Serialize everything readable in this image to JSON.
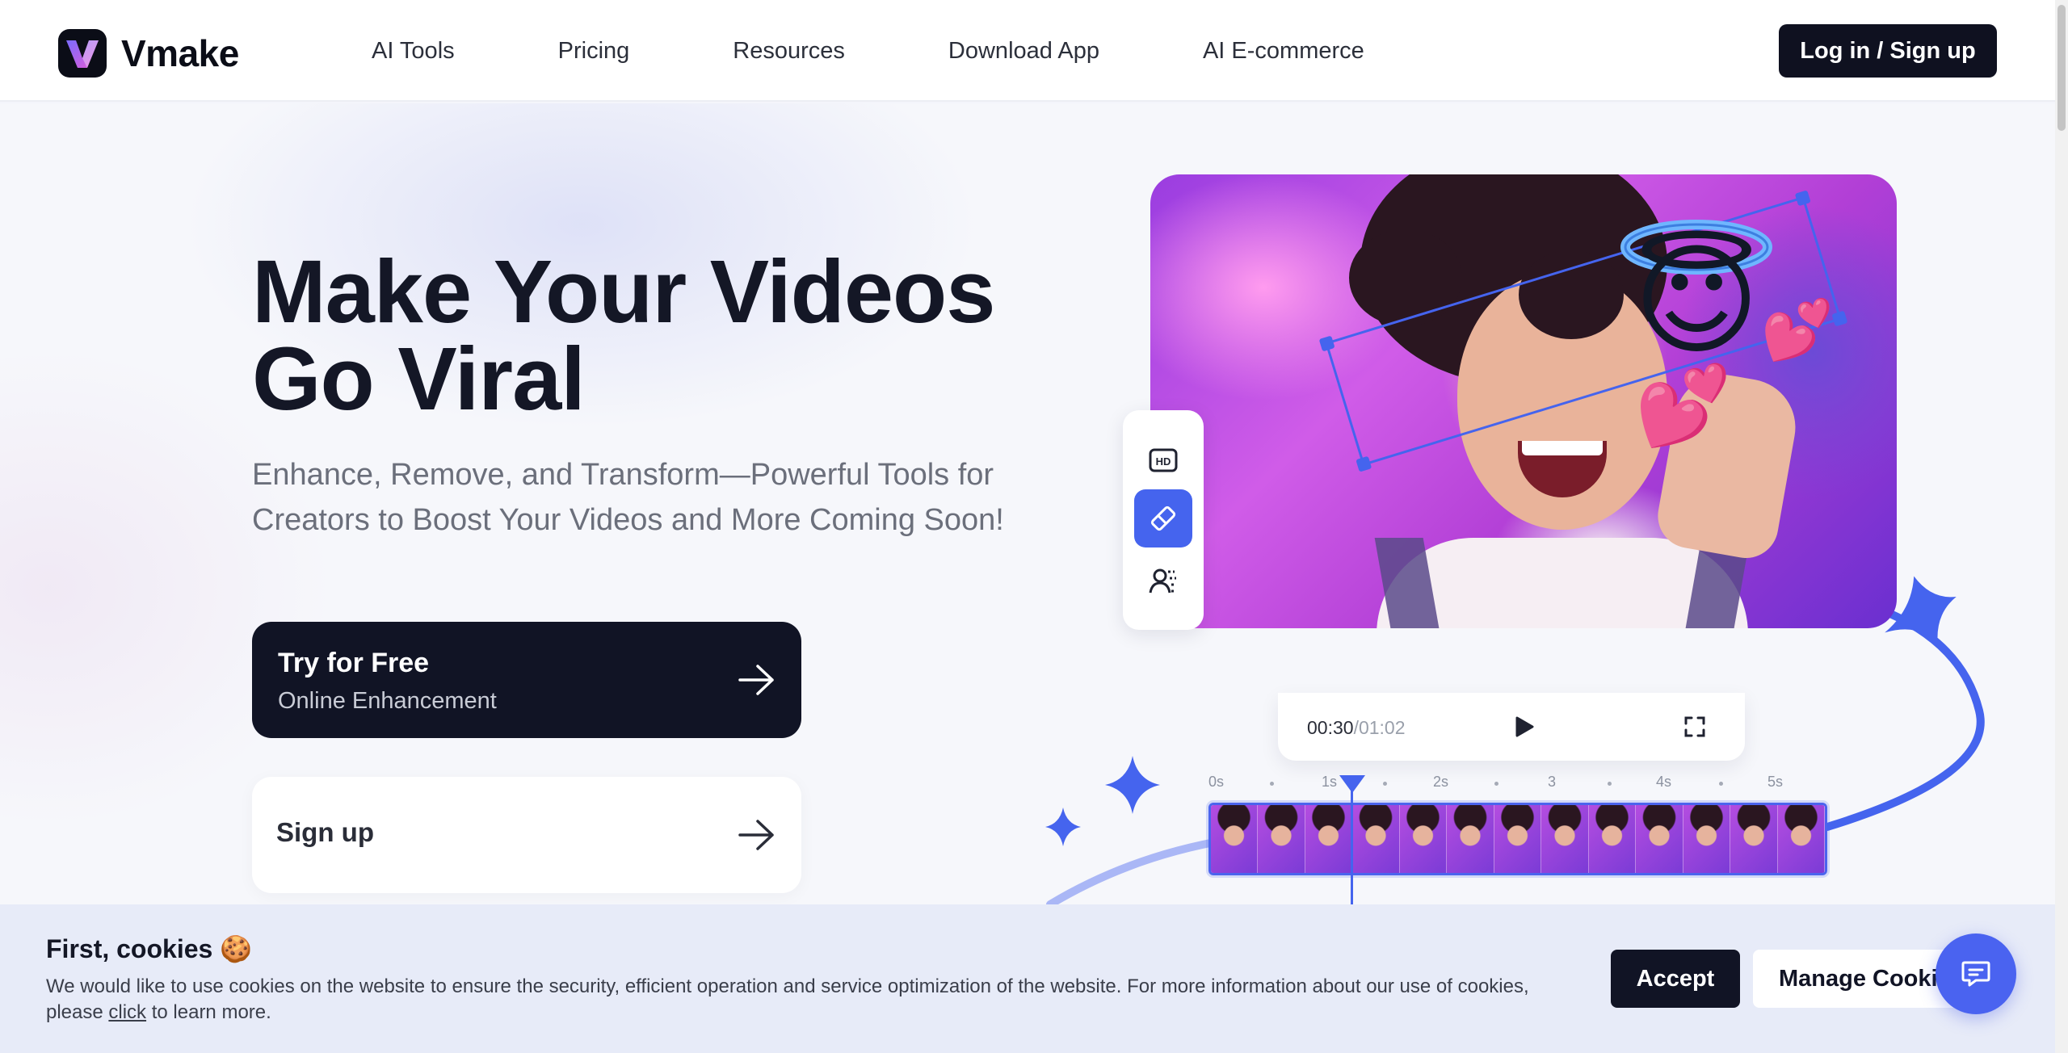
{
  "brand": {
    "name": "Vmake"
  },
  "nav": {
    "items": [
      {
        "label": "AI Tools"
      },
      {
        "label": "Pricing"
      },
      {
        "label": "Resources"
      },
      {
        "label": "Download App"
      },
      {
        "label": "AI E-commerce"
      }
    ],
    "login_label": "Log in / Sign up"
  },
  "hero": {
    "title_line1": "Make Your Videos",
    "title_line2": "Go Viral",
    "subtitle": "Enhance, Remove, and Transform—Powerful Tools for Creators to Boost Your Videos and More Coming Soon!",
    "cta_primary": {
      "title": "Try for Free",
      "subtitle": "Online Enhancement"
    },
    "cta_secondary": {
      "title": "Sign up"
    }
  },
  "editor": {
    "tools": [
      {
        "icon": "hd-icon"
      },
      {
        "icon": "eraser-icon",
        "active": true
      },
      {
        "icon": "portrait-cutout-icon"
      }
    ],
    "player": {
      "current_time": "00:30",
      "duration": "/01:02"
    },
    "ruler": [
      "0s",
      "1s",
      "2s",
      "3",
      "4s",
      "5s"
    ],
    "emoji": "😇",
    "hearts": "💕"
  },
  "cookie": {
    "title": "First, cookies 🍪",
    "text_before": "We would like to use cookies on the website to ensure the security, efficient operation and service optimization of the website. For more information about our use of cookies, please ",
    "link": "click",
    "text_after": " to learn more.",
    "accept_label": "Accept",
    "manage_label": "Manage Cookies"
  },
  "colors": {
    "accent": "#4564ee",
    "dark": "#111425"
  }
}
